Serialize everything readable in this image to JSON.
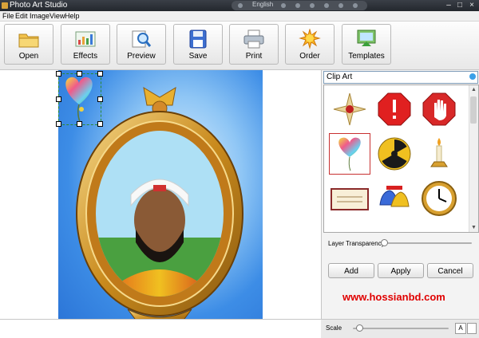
{
  "window": {
    "title": "Photo Art Studio",
    "language": "English",
    "controls": [
      "minimize",
      "maximize",
      "close"
    ]
  },
  "menu": {
    "items": [
      {
        "label": "File"
      },
      {
        "label": "Edit"
      },
      {
        "label": "Image"
      },
      {
        "label": "View"
      },
      {
        "label": "Help"
      }
    ]
  },
  "toolbar": {
    "buttons": [
      {
        "label": "Open",
        "icon": "folder-icon"
      },
      {
        "label": "Effects",
        "icon": "chart-icon"
      },
      {
        "label": "Preview",
        "icon": "magnifier-icon"
      },
      {
        "label": "Save",
        "icon": "floppy-icon"
      },
      {
        "label": "Print",
        "icon": "printer-icon"
      },
      {
        "label": "Order",
        "icon": "sun-icon"
      },
      {
        "label": "Templates",
        "icon": "templates-icon"
      }
    ]
  },
  "panel": {
    "category": "Clip Art",
    "gallery": [
      {
        "name": "ornament",
        "selected": false
      },
      {
        "name": "stop-exclamation",
        "selected": false
      },
      {
        "name": "stop-hand",
        "selected": false
      },
      {
        "name": "heart-balloon",
        "selected": true
      },
      {
        "name": "radiation-sign",
        "selected": false
      },
      {
        "name": "candle",
        "selected": false
      },
      {
        "name": "certificate",
        "selected": false
      },
      {
        "name": "bells",
        "selected": false
      },
      {
        "name": "clock",
        "selected": false
      }
    ],
    "layer_transparency_label": "Layer Transparency",
    "layer_transparency_value": 0,
    "buttons": {
      "add": "Add",
      "apply": "Apply",
      "cancel": "Cancel"
    },
    "watermark": "www.hossianbd.com",
    "scale_label": "Scale",
    "scale_value": 0.05
  },
  "colors": {
    "accent": "#3aa0e8",
    "watermark": "#e00000",
    "sky": "#3d8de6",
    "frame_gold": "#d9a22c"
  }
}
